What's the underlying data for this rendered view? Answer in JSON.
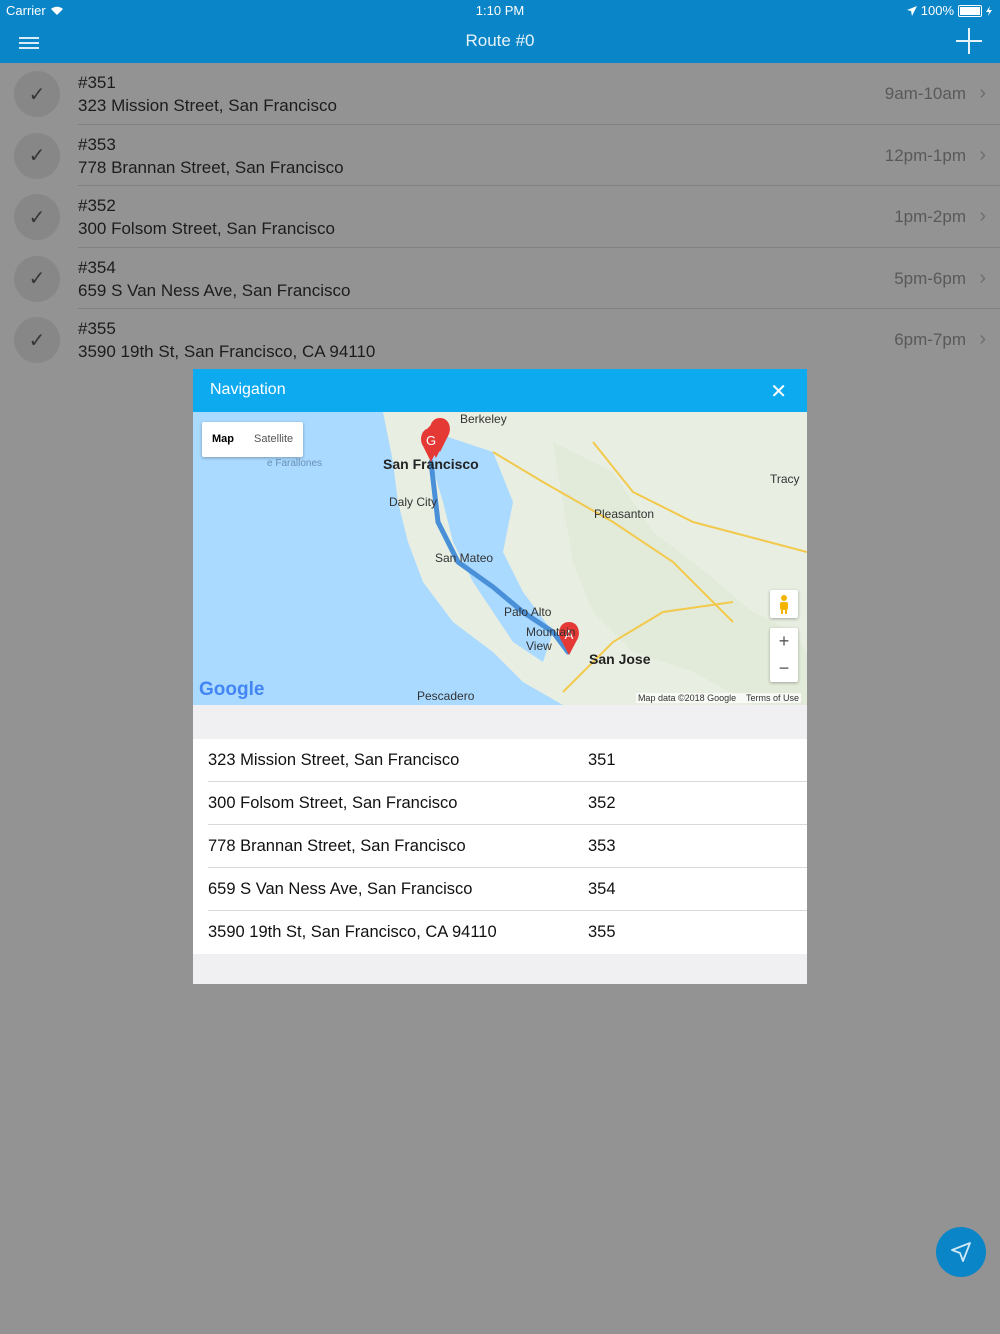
{
  "status_bar": {
    "carrier": "Carrier",
    "time": "1:10 PM",
    "battery": "100%"
  },
  "nav_bar": {
    "title": "Route #0"
  },
  "stops": [
    {
      "number": "#351",
      "address": "323 Mission Street, San Francisco",
      "time": "9am-10am"
    },
    {
      "number": "#353",
      "address": "778 Brannan Street, San Francisco",
      "time": "12pm-1pm"
    },
    {
      "number": "#352",
      "address": "300 Folsom Street, San Francisco",
      "time": "1pm-2pm"
    },
    {
      "number": "#354",
      "address": "659 S Van Ness Ave, San Francisco",
      "time": "5pm-6pm"
    },
    {
      "number": "#355",
      "address": "3590 19th St, San Francisco, CA 94110",
      "time": "6pm-7pm"
    }
  ],
  "modal": {
    "title": "Navigation",
    "map": {
      "toggle_map": "Map",
      "toggle_satellite": "Satellite",
      "attribution": "Map data ©2018 Google",
      "terms": "Terms of Use",
      "logo": "Google",
      "labels": {
        "berkeley": "Berkeley",
        "san_francisco": "San Francisco",
        "farallones": "e Farallones",
        "daly_city": "Daly City",
        "tracy": "Tracy",
        "pleasanton": "Pleasanton",
        "san_mateo": "San Mateo",
        "palo_alto": "Palo Alto",
        "mountain_view": "Mountain View",
        "san_jose": "San Jose",
        "pescadero": "Pescadero"
      },
      "markers": [
        "A",
        "G"
      ]
    },
    "rows": [
      {
        "address": "323 Mission Street, San Francisco",
        "id": "351"
      },
      {
        "address": "300 Folsom Street, San Francisco",
        "id": "352"
      },
      {
        "address": "778 Brannan Street, San Francisco",
        "id": "353"
      },
      {
        "address": "659 S Van Ness Ave, San Francisco",
        "id": "354"
      },
      {
        "address": "3590 19th St, San Francisco, CA 94110",
        "id": "355"
      }
    ]
  },
  "colors": {
    "nav_bar": "#0a85c7",
    "modal_header": "#0eaaf0",
    "fab": "#0a85c7"
  }
}
